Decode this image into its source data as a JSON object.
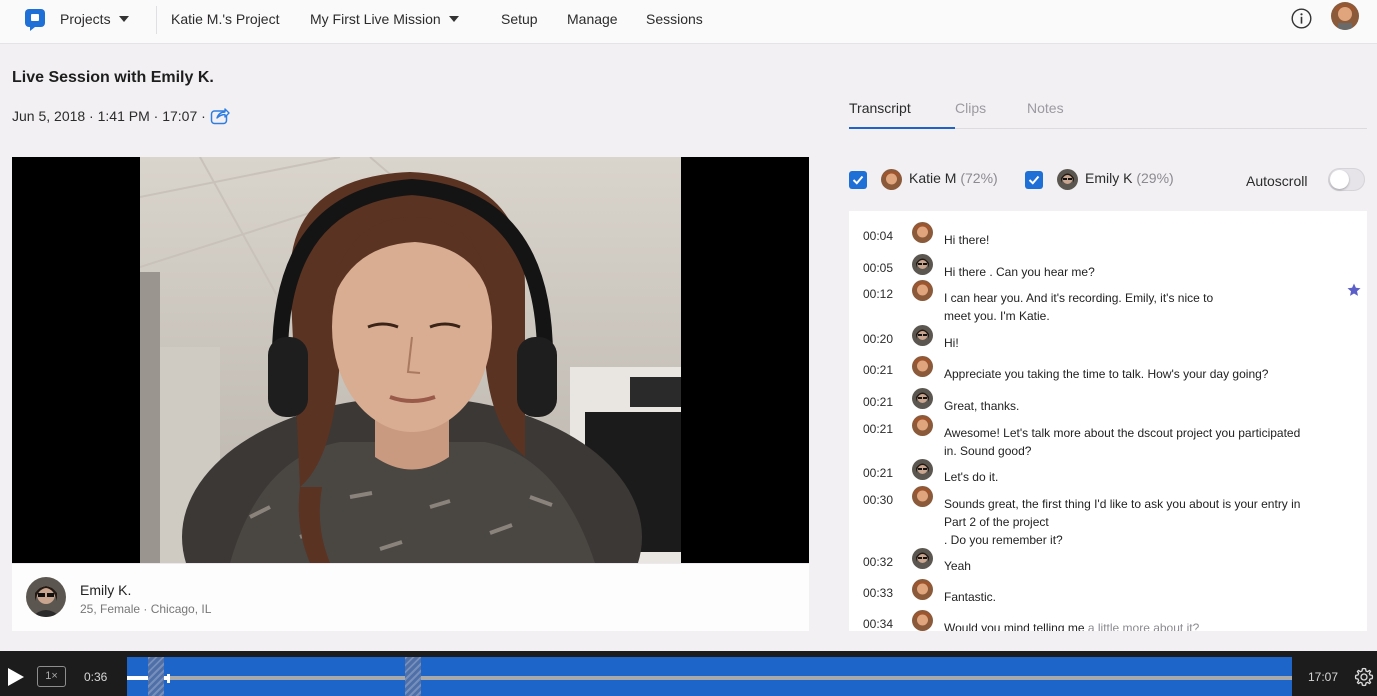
{
  "nav": {
    "projects": "Projects",
    "project_name": "Katie M.'s Project",
    "mission": "My First Live Mission",
    "setup": "Setup",
    "manage": "Manage",
    "sessions": "Sessions"
  },
  "session": {
    "title": "Live Session with Emily K.",
    "meta": "Jun 5, 2018 · 1:41 PM · 17:07 ·"
  },
  "participant": {
    "name": "Emily K.",
    "details": "25, Female · Chicago, IL"
  },
  "tabs": [
    "Transcript",
    "Clips",
    "Notes"
  ],
  "speakers": [
    {
      "name": "Katie M",
      "pct": "(72%)",
      "checked": true
    },
    {
      "name": "Emily K",
      "pct": "(29%)",
      "checked": true
    }
  ],
  "autoscroll": {
    "label": "Autoscroll",
    "on": false
  },
  "transcript": [
    {
      "time": "00:04",
      "speaker": "katie",
      "text": "Hi there!"
    },
    {
      "time": "00:05",
      "speaker": "emily",
      "text": "Hi there . Can you hear me?"
    },
    {
      "time": "00:12",
      "speaker": "katie",
      "text": "I can hear you. And it's recording. Emily, it's nice to\n meet you. I'm Katie.",
      "starred": true
    },
    {
      "time": "00:20",
      "speaker": "emily",
      "text": "Hi!"
    },
    {
      "time": "00:21",
      "speaker": "katie",
      "text": "Appreciate you taking the time to talk. How's your day going?"
    },
    {
      "time": "00:21",
      "speaker": "emily",
      "text": "Great, thanks."
    },
    {
      "time": "00:21",
      "speaker": "katie",
      "text": "Awesome! Let's talk more about the dscout project you participated\nin. Sound good?"
    },
    {
      "time": "00:21",
      "speaker": "emily",
      "text": "Let's do it."
    },
    {
      "time": "00:30",
      "speaker": "katie",
      "text": "Sounds great, the first thing I'd like to ask you about is your entry in\nPart 2 of the project\n. Do you remember it?"
    },
    {
      "time": "00:32",
      "speaker": "emily",
      "text": "Yeah"
    },
    {
      "time": "00:33",
      "speaker": "katie",
      "text": "Fantastic."
    },
    {
      "time": "00:34",
      "speaker": "katie",
      "text": "Would you mind telling me",
      "text_muted": " a little more about it?"
    }
  ],
  "player": {
    "speed": "1×",
    "current": "0:36",
    "duration": "17:07",
    "progress": 0.035
  },
  "colors": {
    "accent": "#1f63c9",
    "timeline": "#1d65c9",
    "star": "#5b5fc7"
  }
}
